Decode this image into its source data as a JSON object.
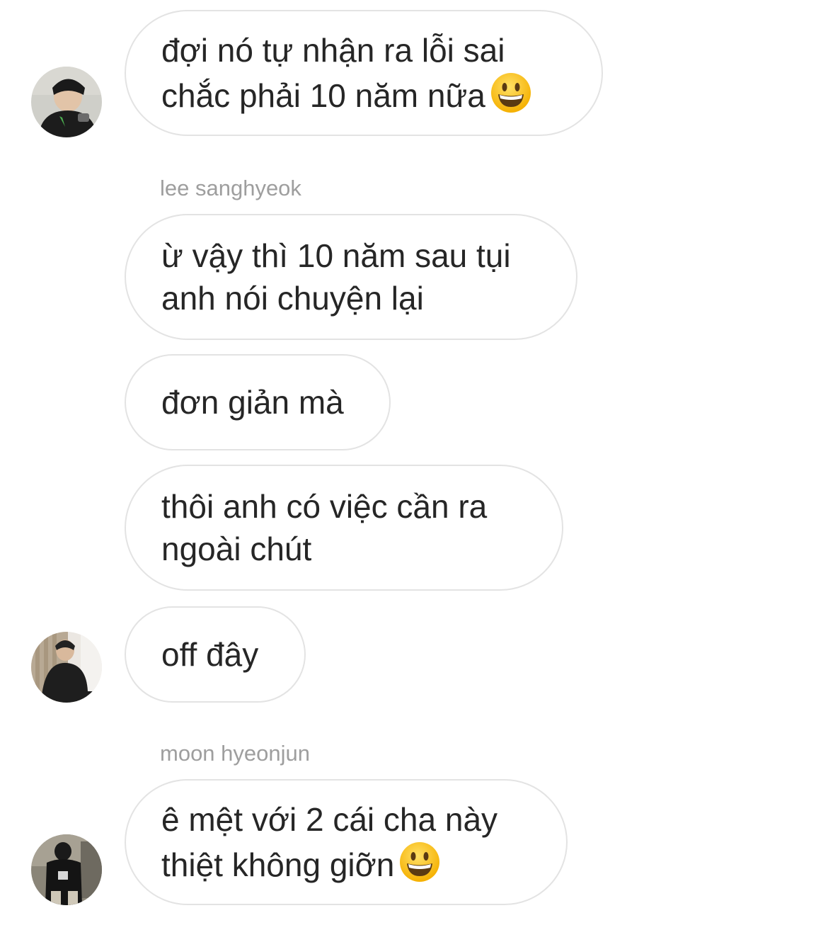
{
  "messages": [
    {
      "lines": [
        "đợi nó tự nhận ra lỗi sai",
        "chắc phải 10 năm nữa"
      ],
      "emoji": "grinning-face-emoji"
    },
    {
      "sender": "lee sanghyeok",
      "lines": [
        "ừ vậy thì 10 năm sau tụi",
        "anh nói chuyện lại"
      ]
    },
    {
      "lines": [
        "đơn giản mà"
      ]
    },
    {
      "lines": [
        "thôi anh có việc cần ra",
        "ngoài chút"
      ]
    },
    {
      "lines": [
        "off đây"
      ]
    },
    {
      "sender": "moon hyeonjun",
      "lines": [
        "ê mệt với 2 cái cha này",
        "thiệt không giỡn"
      ],
      "emoji": "grinning-face-emoji"
    }
  ],
  "colors": {
    "bubble_border": "#e3e3e3",
    "text": "#262626",
    "sender_text": "#9e9e9e",
    "background": "#ffffff"
  },
  "avatars": [
    "avatar-photo-user-1",
    "avatar-photo-user-2",
    "avatar-photo-user-3"
  ]
}
